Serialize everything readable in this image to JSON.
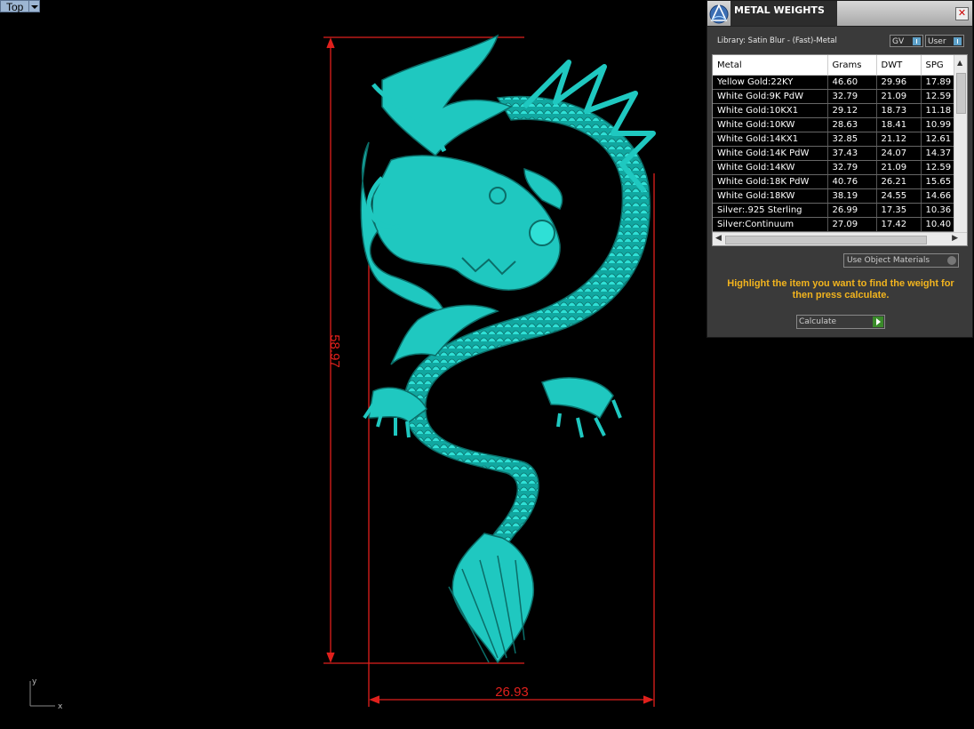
{
  "viewport": {
    "name": "Top",
    "height_dimension": "58.97",
    "width_dimension": "26.93",
    "axis_y": "y",
    "axis_x": "x",
    "model_color": "#1fc8c0",
    "dimension_color": "#e0201c"
  },
  "panel": {
    "title": "METAL WEIGHTS",
    "close_glyph": "✕",
    "library_label": "Library: Satin Blur - (Fast)-Metal",
    "gv_label": "GV",
    "user_label": "User",
    "columns": [
      "Metal",
      "Grams",
      "DWT",
      "SPG"
    ],
    "rows": [
      [
        "Yellow Gold:22KY",
        "46.60",
        "29.96",
        "17.89"
      ],
      [
        "White Gold:9K PdW",
        "32.79",
        "21.09",
        "12.59"
      ],
      [
        "White Gold:10KX1",
        "29.12",
        "18.73",
        "11.18"
      ],
      [
        "White Gold:10KW",
        "28.63",
        "18.41",
        "10.99"
      ],
      [
        "White Gold:14KX1",
        "32.85",
        "21.12",
        "12.61"
      ],
      [
        "White Gold:14K PdW",
        "37.43",
        "24.07",
        "14.37"
      ],
      [
        "White Gold:14KW",
        "32.79",
        "21.09",
        "12.59"
      ],
      [
        "White Gold:18K PdW",
        "40.76",
        "26.21",
        "15.65"
      ],
      [
        "White Gold:18KW",
        "38.19",
        "24.55",
        "14.66"
      ],
      [
        "Silver:.925 Sterling",
        "26.99",
        "17.35",
        "10.36"
      ],
      [
        "Silver:Continuum",
        "27.09",
        "17.42",
        "10.40"
      ]
    ],
    "use_object_materials": "Use Object Materials",
    "hint": "Highlight the item you want to find the weight for then press calculate.",
    "calculate": "Calculate",
    "accent_color": "#f2b41e"
  }
}
